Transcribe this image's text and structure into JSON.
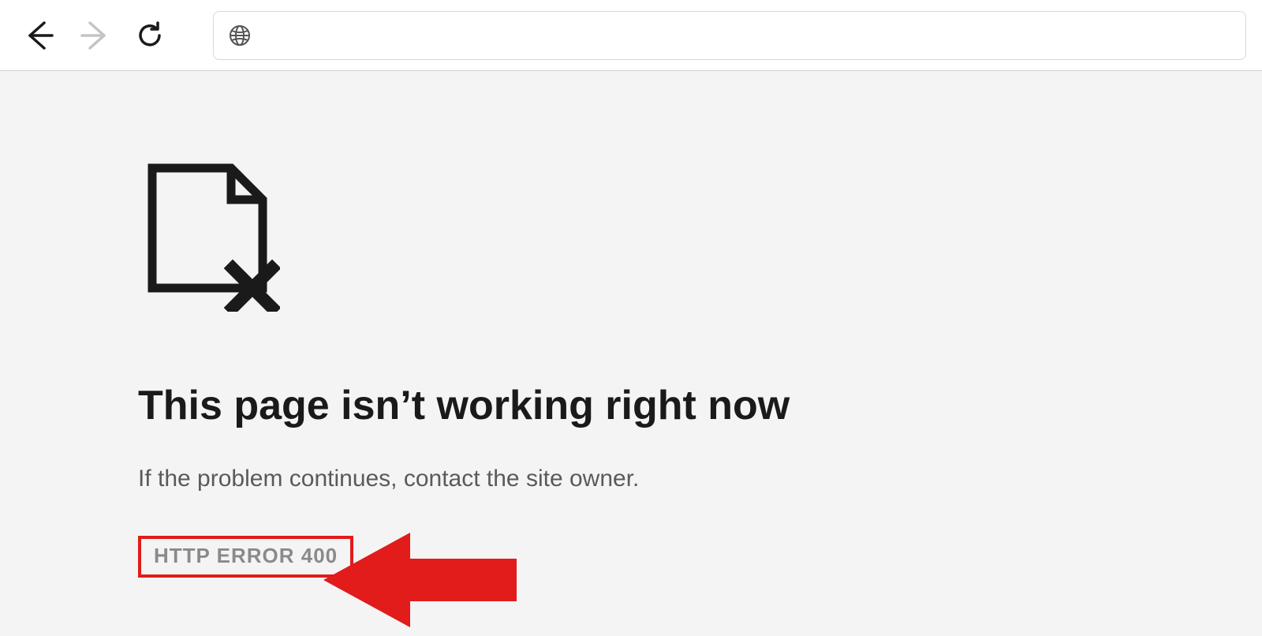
{
  "toolbar": {
    "address_value": ""
  },
  "error": {
    "title": "This page isn’t working right now",
    "message": "If the problem continues, contact the site owner.",
    "code": "HTTP ERROR 400"
  }
}
